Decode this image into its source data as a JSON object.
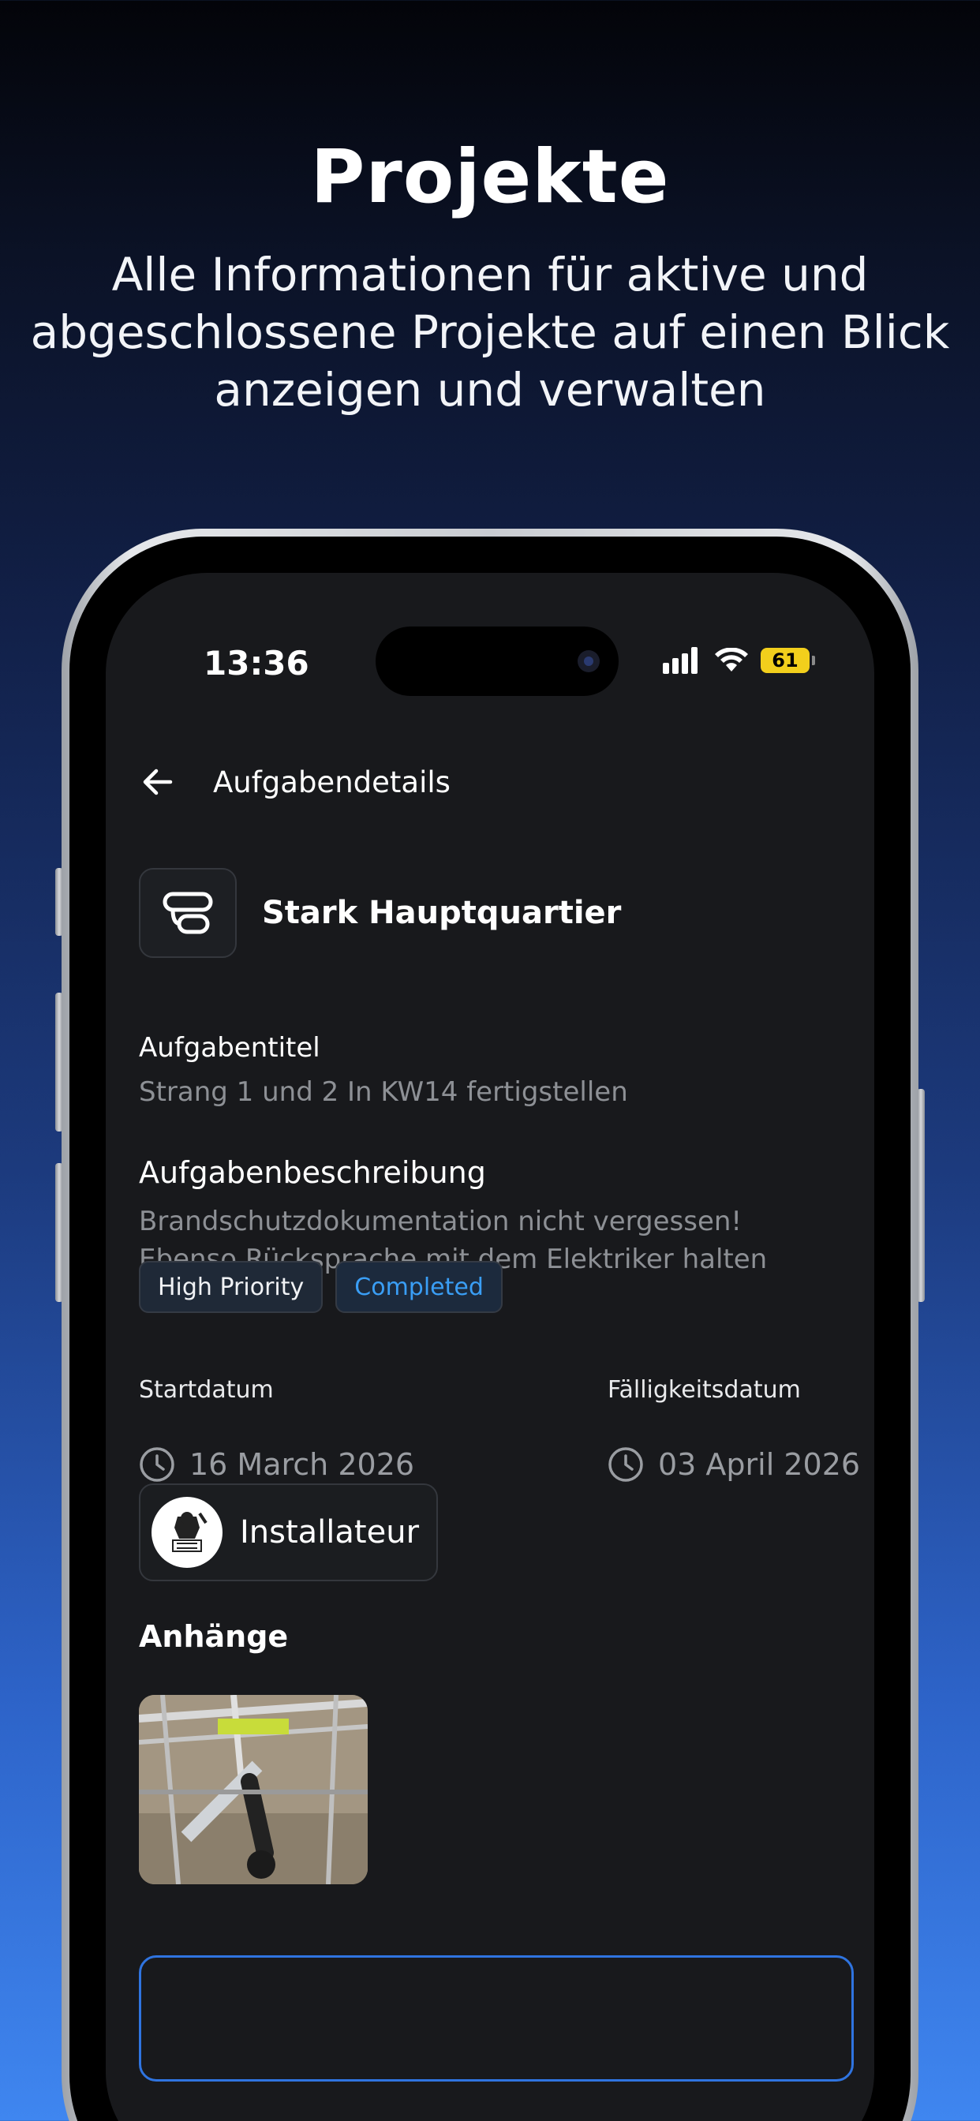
{
  "hero": {
    "title": "Projekte",
    "subtitle_line1": "Alle Informationen für aktive und",
    "subtitle_line2": "abgeschlossene Projekte auf einen Blick",
    "subtitle_line3": "anzeigen und verwalten"
  },
  "status_bar": {
    "time": "13:36",
    "battery": "61",
    "icons": [
      "signal-icon",
      "wifi-icon",
      "battery-icon"
    ]
  },
  "nav": {
    "title": "Aufgabendetails",
    "back_icon": "arrow-left-icon"
  },
  "project": {
    "name": "Stark Hauptquartier",
    "icon": "project-logo-icon"
  },
  "task": {
    "title_label": "Aufgabentitel",
    "title_value": "Strang 1 und 2 In KW14 fertigstellen",
    "description_label": "Aufgabenbeschreibung",
    "description_line1": "Brandschutzdokumentation nicht vergessen!",
    "description_line2": "Ebenso Rücksprache mit dem Elektriker halten"
  },
  "chips": {
    "priority": "High Priority",
    "status": "Completed"
  },
  "dates": {
    "start_label": "Startdatum",
    "start_value": "16 March 2026",
    "due_label": "Fälligkeitsdatum",
    "due_value": "03 April 2026"
  },
  "assignee": {
    "role": "Installateur"
  },
  "attachments": {
    "heading": "Anhänge"
  },
  "colors": {
    "accent_blue": "#3a9ef5",
    "button_border": "#2f74e0",
    "battery": "#f2cf1c",
    "screen_bg": "#18191c"
  }
}
